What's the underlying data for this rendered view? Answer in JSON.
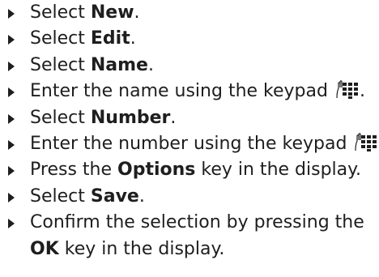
{
  "steps": [
    {
      "pre": "Select ",
      "bold": "New",
      "post": "."
    },
    {
      "pre": "Select ",
      "bold": "Edit",
      "post": "."
    },
    {
      "pre": "Select ",
      "bold": "Name",
      "post": "."
    },
    {
      "pre": "Enter the name using the keypad ",
      "icon": "keypad-icon",
      "post": "."
    },
    {
      "pre": "Select ",
      "bold": "Number",
      "post": "."
    },
    {
      "pre": "Enter the number using the keypad ",
      "icon": "keypad-icon",
      "post": "."
    },
    {
      "pre": "Press the ",
      "bold": "Options",
      "post": " key in the display."
    },
    {
      "pre": "Select ",
      "bold": "Save",
      "post": "."
    },
    {
      "pre": "Confirm the selection by pressing the ",
      "bold": "OK",
      "post": " key in the display."
    }
  ],
  "colors": {
    "text": "#1e1e1e",
    "background": "#ffffff"
  }
}
